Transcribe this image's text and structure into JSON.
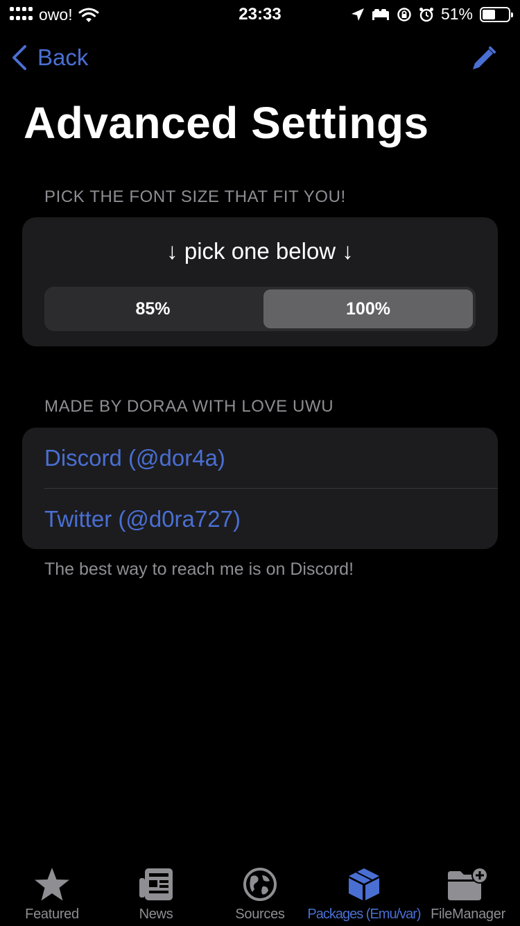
{
  "status_bar": {
    "carrier": "owo!",
    "time": "23:33",
    "battery": "51%",
    "battery_level": 0.51
  },
  "nav": {
    "back_label": "Back"
  },
  "page": {
    "title": "Advanced Settings"
  },
  "font_size_section": {
    "header": "PICK THE FONT SIZE THAT FIT YOU!",
    "prompt": "↓ pick one below ↓",
    "options": [
      "85%",
      "100%"
    ],
    "selected": "100%"
  },
  "credits_section": {
    "header": "MADE BY DORAA WITH LOVE UWU",
    "links": [
      {
        "label": "Discord (@dor4a)"
      },
      {
        "label": "Twitter (@d0ra727)"
      }
    ],
    "footer": "The best way to reach me is on Discord!"
  },
  "tab_bar": {
    "tabs": [
      {
        "label": "Featured",
        "icon": "star-icon"
      },
      {
        "label": "News",
        "icon": "newspaper-icon"
      },
      {
        "label": "Sources",
        "icon": "globe-icon"
      },
      {
        "label": "Packages (Emu/var)",
        "icon": "package-icon",
        "active": true
      },
      {
        "label": "FileManager",
        "icon": "folder-plus-icon"
      }
    ]
  },
  "colors": {
    "accent": "#4a6fd3",
    "background": "#000000",
    "card": "#1c1c1e",
    "secondary_text": "#8e8e93"
  }
}
